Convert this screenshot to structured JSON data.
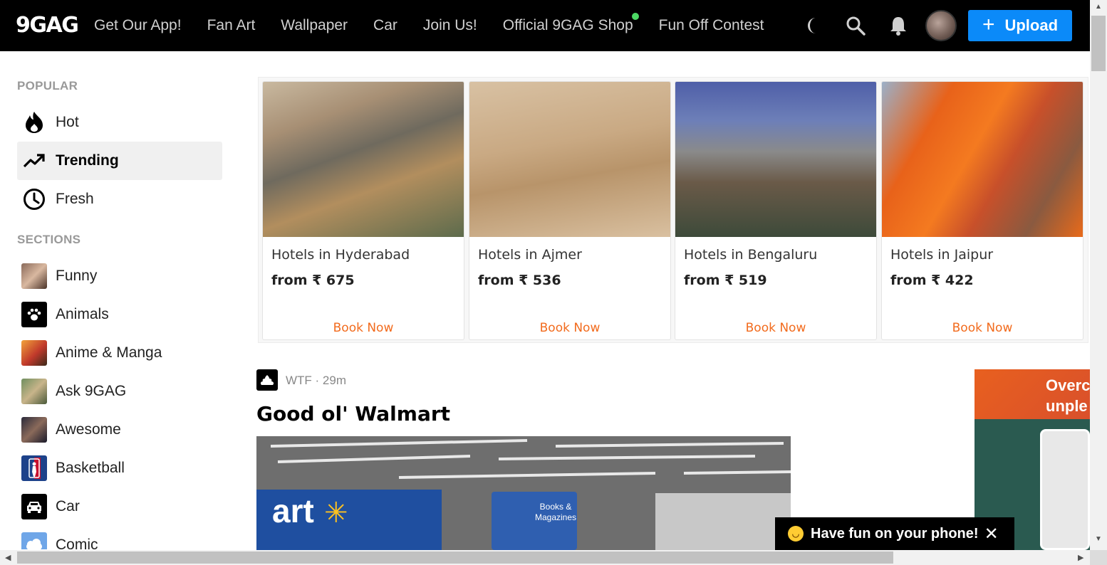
{
  "header": {
    "logo": "9GAG",
    "nav": [
      "Get Our App!",
      "Fan Art",
      "Wallpaper",
      "Car",
      "Join Us!",
      "Official 9GAG Shop",
      "Fun Off Contest"
    ],
    "upload_label": "Upload",
    "icons": [
      "moon-icon",
      "search-icon",
      "bell-icon",
      "avatar"
    ]
  },
  "sidebar": {
    "popular_title": "POPULAR",
    "popular": [
      {
        "label": "Hot",
        "icon": "flame-icon"
      },
      {
        "label": "Trending",
        "icon": "trending-icon",
        "active": true
      },
      {
        "label": "Fresh",
        "icon": "clock-icon"
      }
    ],
    "sections_title": "SECTIONS",
    "sections": [
      {
        "label": "Funny",
        "icon": "funny-thumb"
      },
      {
        "label": "Animals",
        "icon": "paw-icon"
      },
      {
        "label": "Anime & Manga",
        "icon": "anime-thumb"
      },
      {
        "label": "Ask 9GAG",
        "icon": "ask-thumb"
      },
      {
        "label": "Awesome",
        "icon": "awesome-thumb"
      },
      {
        "label": "Basketball",
        "icon": "nba-icon"
      },
      {
        "label": "Car",
        "icon": "car-icon"
      },
      {
        "label": "Comic",
        "icon": "cloud-icon"
      }
    ]
  },
  "hotel_ads": [
    {
      "name": "Hotels in Hyderabad",
      "price": "from ₹ 675",
      "cta": "Book Now"
    },
    {
      "name": "Hotels in Ajmer",
      "price": "from ₹ 536",
      "cta": "Book Now"
    },
    {
      "name": "Hotels in Bengaluru",
      "price": "from ₹ 519",
      "cta": "Book Now"
    },
    {
      "name": "Hotels in Jaipur",
      "price": "from ₹ 422",
      "cta": "Book Now"
    }
  ],
  "post": {
    "section_time": "WTF · 29m",
    "title": "Good ol' Walmart",
    "image_sign_text": "Books & Magazines",
    "image_store_text": "art"
  },
  "right_ad": {
    "line1": "Overc",
    "line2": "unple"
  },
  "toast": {
    "text": "Have fun on your phone!",
    "close": "✕"
  },
  "colors": {
    "accent": "#0b8af9",
    "book_now": "#f26b1d",
    "header_bg": "#000000",
    "online_dot": "#4cd964"
  }
}
